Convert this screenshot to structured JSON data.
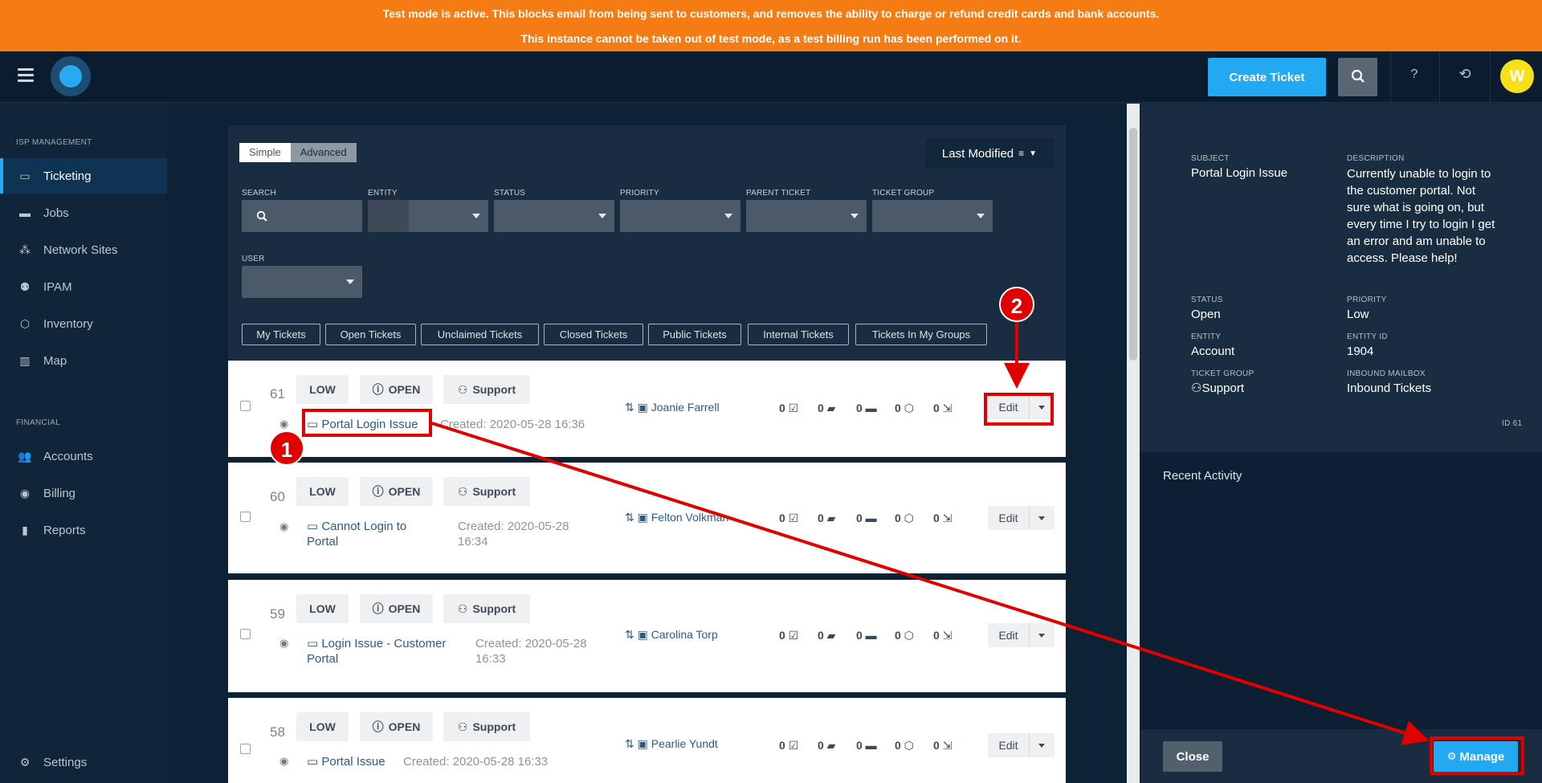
{
  "banner": {
    "line1": "Test mode is active. This blocks email from being sent to customers, and removes the ability to charge or refund credit cards and bank accounts.",
    "line2": "This instance cannot be taken out of test mode, as a test billing run has been performed on it."
  },
  "topbar": {
    "create_label": "Create Ticket",
    "help_label": "?",
    "history_label": "⟲",
    "avatar_initial": "W"
  },
  "sidebar": {
    "section1": "ISP MANAGEMENT",
    "section2": "FINANCIAL",
    "items": [
      {
        "label": "Ticketing",
        "icon": "ticket-icon"
      },
      {
        "label": "Jobs",
        "icon": "briefcase-icon"
      },
      {
        "label": "Network Sites",
        "icon": "network-icon"
      },
      {
        "label": "IPAM",
        "icon": "ipam-icon"
      },
      {
        "label": "Inventory",
        "icon": "box-icon"
      },
      {
        "label": "Map",
        "icon": "map-icon"
      },
      {
        "label": "Accounts",
        "icon": "users-icon"
      },
      {
        "label": "Billing",
        "icon": "piggy-bank-icon"
      },
      {
        "label": "Reports",
        "icon": "bar-chart-icon"
      },
      {
        "label": "Settings",
        "icon": "gear-icon"
      }
    ]
  },
  "filters": {
    "mode_simple": "Simple",
    "mode_advanced": "Advanced",
    "sort_label": "Last Modified",
    "labels": {
      "search": "SEARCH",
      "entity": "ENTITY",
      "status": "STATUS",
      "priority": "PRIORITY",
      "parent": "PARENT TICKET",
      "group": "TICKET GROUP",
      "user": "USER"
    },
    "quick": [
      "My Tickets",
      "Open Tickets",
      "Unclaimed Tickets",
      "Closed Tickets",
      "Public Tickets",
      "Internal Tickets",
      "Tickets In My Groups"
    ]
  },
  "tickets": [
    {
      "id": "61",
      "priority": "LOW",
      "status": "OPEN",
      "group": "Support",
      "subject": "Portal Login Issue",
      "created_label": "Created:",
      "created": "2020-05-28 16:36",
      "assignee": "Joanie Farrell",
      "counts": [
        "0",
        "0",
        "0",
        "0",
        "0"
      ],
      "edit": "Edit"
    },
    {
      "id": "60",
      "priority": "LOW",
      "status": "OPEN",
      "group": "Support",
      "subject": "Cannot Login to Portal",
      "created_label": "Created:",
      "created": "2020-05-28 16:34",
      "assignee": "Felton Volkman",
      "counts": [
        "0",
        "0",
        "0",
        "0",
        "0"
      ],
      "edit": "Edit"
    },
    {
      "id": "59",
      "priority": "LOW",
      "status": "OPEN",
      "group": "Support",
      "subject": "Login Issue - Customer Portal",
      "created_label": "Created:",
      "created": "2020-05-28 16:33",
      "assignee": "Carolina Torp",
      "counts": [
        "0",
        "0",
        "0",
        "0",
        "0"
      ],
      "edit": "Edit"
    },
    {
      "id": "58",
      "priority": "LOW",
      "status": "OPEN",
      "group": "Support",
      "subject": "Portal Issue",
      "created_label": "Created:",
      "created": "2020-05-28 16:33",
      "assignee": "Pearlie Yundt",
      "counts": [
        "0",
        "0",
        "0",
        "0",
        "0"
      ],
      "edit": "Edit"
    }
  ],
  "detail": {
    "subject_label": "SUBJECT",
    "subject": "Portal Login Issue",
    "description_label": "DESCRIPTION",
    "description": "Currently unable to login to the customer portal. Not sure what is going on, but every time I try to login I get an error and am unable to access. Please help!",
    "status_label": "STATUS",
    "status": "Open",
    "priority_label": "PRIORITY",
    "priority": "Low",
    "entity_label": "ENTITY",
    "entity": "Account",
    "entity_id_label": "ENTITY ID",
    "entity_id": "1904",
    "group_label": "TICKET GROUP",
    "group": "Support",
    "mailbox_label": "INBOUND MAILBOX",
    "mailbox": "Inbound Tickets",
    "id_text": "ID 61",
    "recent_activity": "Recent Activity",
    "close_label": "Close",
    "manage_label": "Manage"
  },
  "annotations": {
    "badge1": "1",
    "badge2": "2",
    "color": "#e00000"
  }
}
